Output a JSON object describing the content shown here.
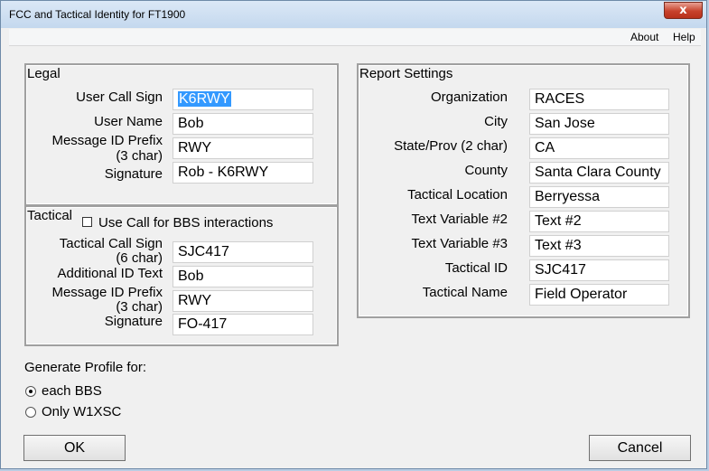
{
  "window": {
    "title": "FCC and Tactical Identity for FT1900",
    "close_glyph": "x"
  },
  "menu": {
    "about": "About",
    "help": "Help"
  },
  "legal": {
    "title": "Legal",
    "user_call_sign_label": "User Call Sign",
    "user_call_sign_value": "K6RWY",
    "user_name_label": "User Name",
    "user_name_value": "Bob",
    "message_id_prefix_label_1": "Message ID Prefix",
    "message_id_prefix_label_2": "(3 char)",
    "message_id_prefix_value": "RWY",
    "signature_label": "Signature",
    "signature_value": "Rob - K6RWY"
  },
  "tactical": {
    "title": "Tactical",
    "use_call_label": "Use Call for BBS interactions",
    "use_call_checked": false,
    "call_sign_label_1": "Tactical Call Sign",
    "call_sign_label_2": "(6 char)",
    "call_sign_value": "SJC417",
    "additional_id_label": "Additional ID Text",
    "additional_id_value": "Bob",
    "message_id_prefix_label_1": "Message ID Prefix",
    "message_id_prefix_label_2": "(3 char)",
    "message_id_prefix_value": "RWY",
    "signature_label": "Signature",
    "signature_value": "FO-417"
  },
  "report": {
    "title": "Report Settings",
    "fields": [
      {
        "label": "Organization",
        "value": "RACES"
      },
      {
        "label": "City",
        "value": "San Jose"
      },
      {
        "label": "State/Prov (2 char)",
        "value": "CA"
      },
      {
        "label": "County",
        "value": "Santa Clara County"
      },
      {
        "label": "Tactical Location",
        "value": "Berryessa"
      },
      {
        "label": "Text Variable #2",
        "value": "Text #2"
      },
      {
        "label": "Text Variable #3",
        "value": "Text #3"
      },
      {
        "label": "Tactical ID",
        "value": "SJC417"
      },
      {
        "label": "Tactical Name",
        "value": "Field Operator"
      }
    ]
  },
  "profile": {
    "label": "Generate Profile for:",
    "option_each": "each BBS",
    "option_only": "Only W1XSC",
    "selected": "each BBS"
  },
  "buttons": {
    "ok": "OK",
    "cancel": "Cancel"
  }
}
